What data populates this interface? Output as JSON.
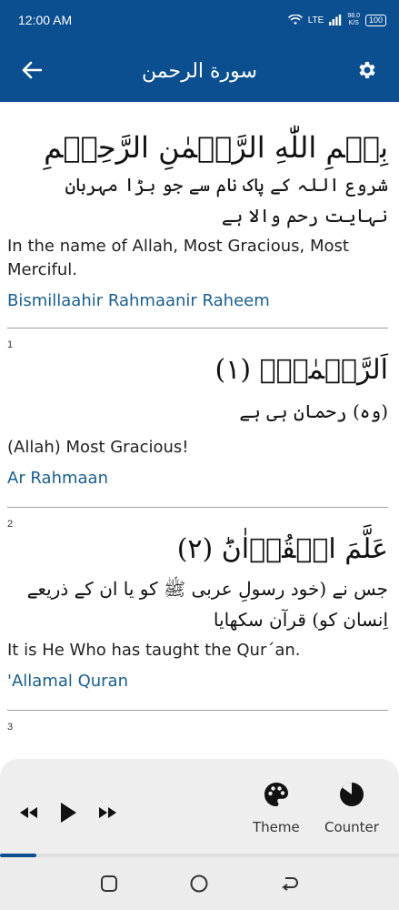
{
  "status_bar": {
    "time": "12:00 AM",
    "network": "LTE",
    "speed_value": "98.0",
    "speed_unit": "K/S",
    "battery": "100"
  },
  "app_bar": {
    "title": "سورة الرحمن",
    "back_icon": "arrow-left-icon",
    "settings_icon": "gear-icon"
  },
  "verses": [
    {
      "number": "",
      "arabic": "بِسۡمِ اللّٰهِ الرَّحۡمٰنِ الرَّحِيۡمِ",
      "urdu": "شروع اللہ کے پاک نام سے جو بڑا مہربان نہایت رحم والا ہے",
      "english": "In the name of Allah, Most Gracious, Most Merciful.",
      "transliteration": "Bismillaahir Rahmaanir Raheem"
    },
    {
      "number": "1",
      "arabic": "اَلرَّحۡمٰنُۙ‏ (۱)",
      "urdu": "(وہ) رحمان ہی ہے",
      "english": "(Allah) Most Gracious!",
      "transliteration": "Ar Rahmaan"
    },
    {
      "number": "2",
      "arabic": "عَلَّمَ الۡقُرۡاٰنَؕ‏ (۲)",
      "urdu": "جس نے (خود رسولِ عربی ﷺ کو یا ان کے ذریعے اِنسان کو) قرآن سکھایا",
      "english": "It is He Who has taught the Qur´an.",
      "transliteration": "'Allamal Quran"
    },
    {
      "number": "3",
      "arabic": "",
      "urdu": "",
      "english": "",
      "transliteration": ""
    }
  ],
  "player": {
    "theme_label": "Theme",
    "counter_label": "Counter",
    "progress_percent": 9,
    "accent": "#0b4f91"
  },
  "nav": {
    "recent_icon": "square-icon",
    "home_icon": "circle-icon",
    "back_icon": "return-arrow-icon"
  }
}
